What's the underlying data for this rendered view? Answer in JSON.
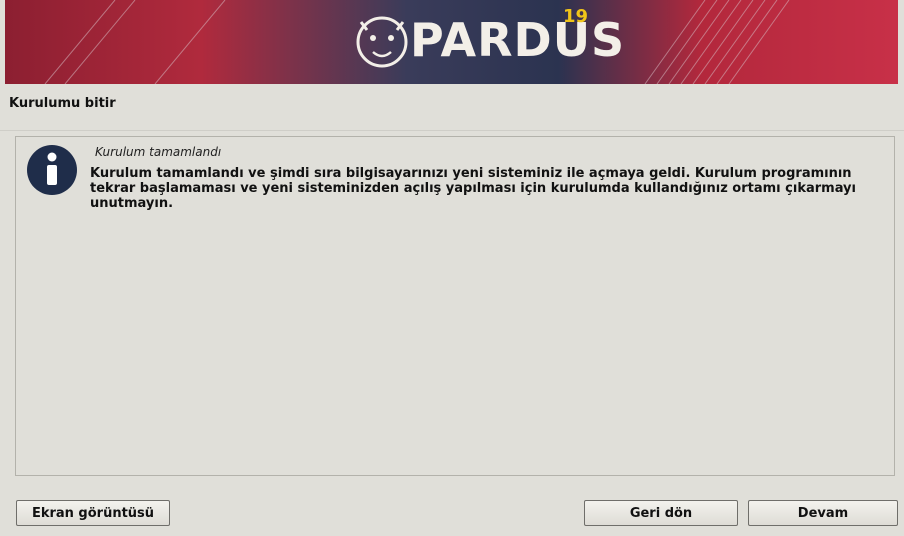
{
  "banner": {
    "brand": "PARDUS",
    "version": "19"
  },
  "page": {
    "title": "Kurulumu bitir"
  },
  "message": {
    "title": "Kurulum tamamlandı",
    "body": "Kurulum tamamlandı ve şimdi sıra bilgisayarınızı yeni sisteminiz ile açmaya geldi. Kurulum programının tekrar başlamaması ve yeni sisteminizden açılış yapılması için kurulumda kullandığınız ortamı çıkarmayı unutmayın.",
    "icon": "info-icon"
  },
  "buttons": {
    "screenshot_label": "Ekran görüntüsü",
    "back_label": "Geri dön",
    "continue_label": "Devam"
  },
  "colors": {
    "banner_red": "#b3283c",
    "banner_dark": "#2a3550",
    "icon_navy": "#1f2d4a"
  }
}
